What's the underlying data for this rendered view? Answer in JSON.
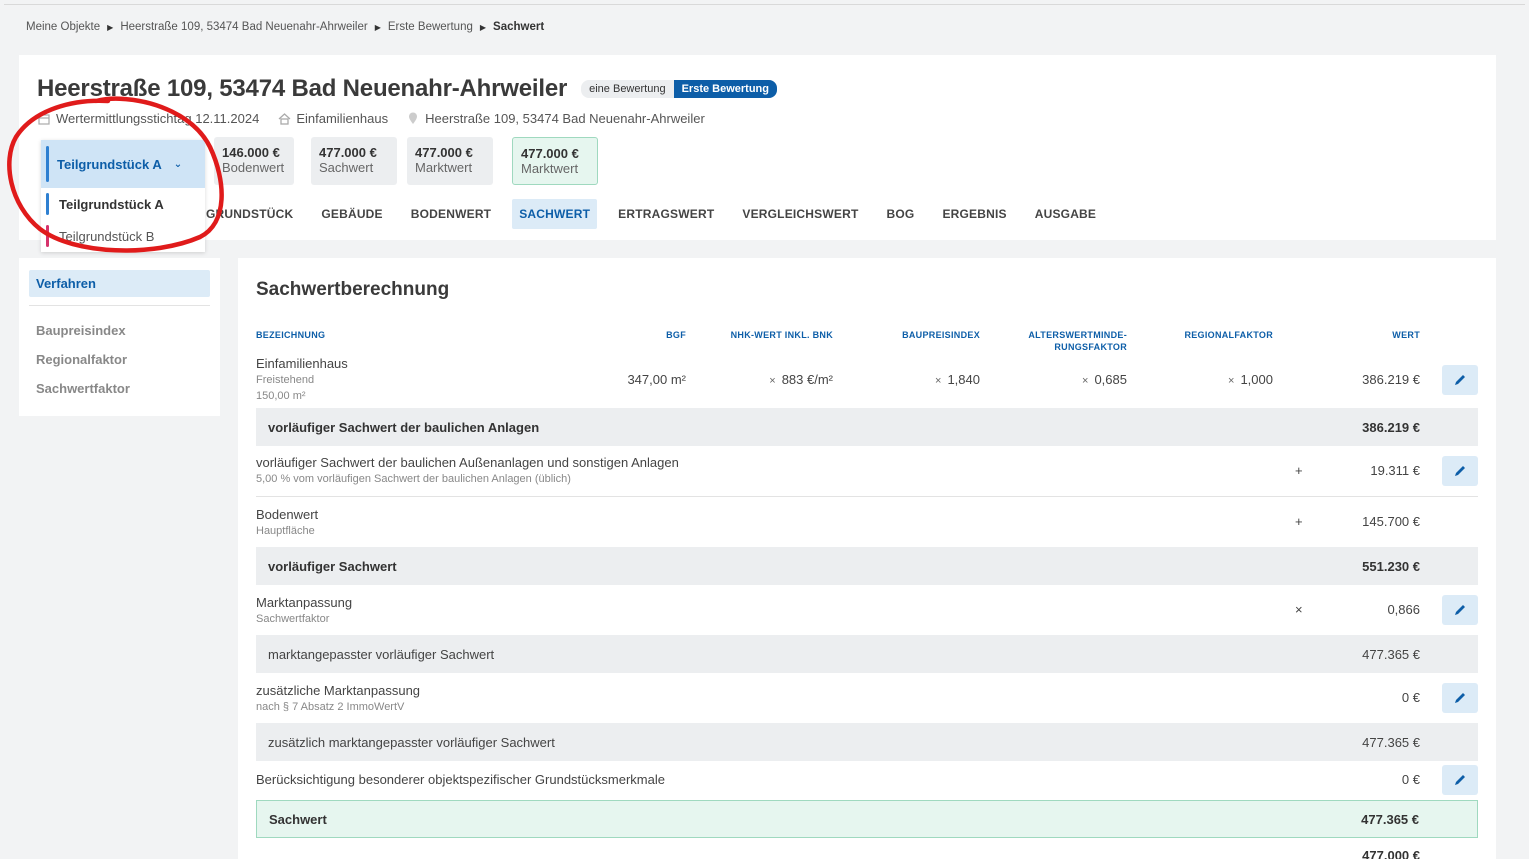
{
  "breadcrumb": [
    "Meine Objekte",
    "Heerstraße 109, 53474 Bad Neuenahr-Ahrweiler",
    "Erste Bewertung",
    "Sachwert"
  ],
  "header": {
    "title": "Heerstraße 109, 53474 Bad Neuenahr-Ahrweiler",
    "badge_type": "eine Bewertung",
    "badge_name": "Erste Bewertung",
    "meta": {
      "date_label": "Wertermittlungsstichtag",
      "date": "12.11.2024",
      "type": "Einfamilienhaus",
      "address": "Heerstraße 109, 53474 Bad Neuenahr-Ahrweiler"
    },
    "values": [
      {
        "amount": "146.000 €",
        "label": "Bodenwert"
      },
      {
        "amount": "477.000 €",
        "label": "Sachwert"
      },
      {
        "amount": "477.000 €",
        "label": "Marktwert"
      },
      {
        "amount": "477.000 €",
        "label": "Marktwert"
      }
    ]
  },
  "dropdown": {
    "selected": "Teilgrundstück A",
    "options": [
      "Teilgrundstück A",
      "Teilgrundstück B"
    ]
  },
  "tabs": [
    "GRUNDSTÜCK",
    "GEBÄUDE",
    "BODENWERT",
    "SACHWERT",
    "ERTRAGSWERT",
    "VERGLEICHSWERT",
    "BOG",
    "ERGEBNIS",
    "AUSGABE"
  ],
  "tabs_visible": [
    "GRUNDSTÜCK",
    "GEBÄUDE",
    "BODENWERT",
    "SACHWERT",
    "ERTRAGSWERT",
    "VERGLEICHSWERT",
    "BOG",
    "ERGEBNIS",
    "AUSGABE"
  ],
  "sidebar": {
    "active": "Verfahren",
    "items": [
      "Baupreisindex",
      "Regionalfaktor",
      "Sachwertfaktor"
    ]
  },
  "main": {
    "title": "Sachwertberechnung",
    "headers": {
      "bezeichnung": "BEZEICHNUNG",
      "bgf": "BGF",
      "nhk": "NHK-WERT INKL. BNK",
      "baupreisindex": "BAUPREISINDEX",
      "alter1": "ALTERSWERTMINDE-",
      "alter2": "RUNGSFAKTOR",
      "regional": "REGIONALFAKTOR",
      "wert": "WERT"
    },
    "building": {
      "name": "Einfamilienhaus",
      "sub1": "Freistehend",
      "sub2": "150,00 m²",
      "bgf": "347,00 m²",
      "nhk": "883 €/m²",
      "index": "1,840",
      "alter": "0,685",
      "regional": "1,000",
      "wert": "386.219 €"
    },
    "sum1": {
      "label": "vorläufiger Sachwert der baulichen Anlagen",
      "value": "386.219 €"
    },
    "aussen": {
      "label": "vorläufiger Sachwert der baulichen Außenanlagen und sonstigen Anlagen",
      "sub": "5,00 % vom vorläufigen Sachwert der baulichen Anlagen (üblich)",
      "op": "+",
      "value": "19.311 €"
    },
    "boden": {
      "label": "Bodenwert",
      "sub": "Hauptfläche",
      "op": "+",
      "value": "145.700 €"
    },
    "sum2": {
      "label": "vorläufiger Sachwert",
      "value": "551.230 €"
    },
    "markt": {
      "label": "Marktanpassung",
      "sub": "Sachwertfaktor",
      "op": "×",
      "value": "0,866"
    },
    "sum3": {
      "label": "marktangepasster vorläufiger Sachwert",
      "value": "477.365 €"
    },
    "zusatz": {
      "label": "zusätzliche Marktanpassung",
      "sub": "nach § 7 Absatz 2 ImmoWertV",
      "value": "0 €"
    },
    "sum4": {
      "label": "zusätzlich marktangepasster vorläufiger Sachwert",
      "value": "477.365 €"
    },
    "besondere": {
      "label": "Berücksichtigung besonderer objektspezifischer Grundstücksmerkmale",
      "value": "0 €"
    },
    "sachwert": {
      "label": "Sachwert",
      "value": "477.365 €"
    },
    "rounded": "477.000 €"
  },
  "colors": {
    "accent": "#0d5ea8",
    "annotation": "#e01b1b",
    "success_bg": "#e6f6ef"
  }
}
